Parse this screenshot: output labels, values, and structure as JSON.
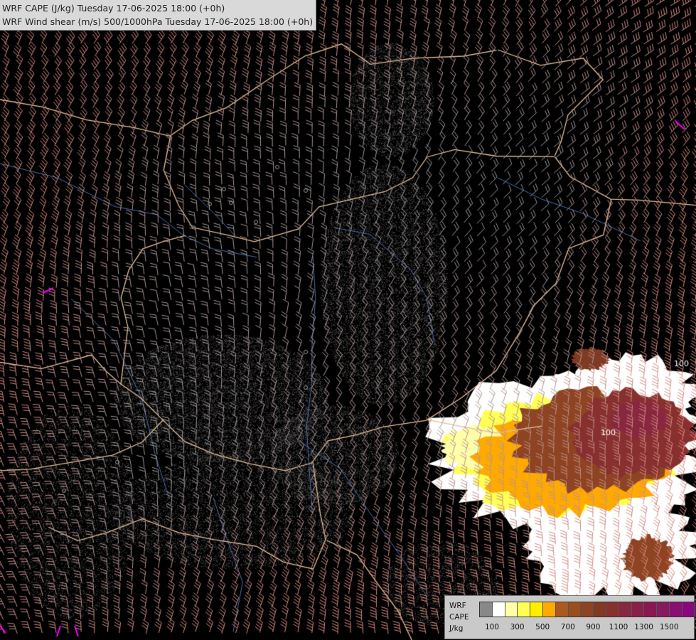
{
  "header": {
    "line1": "WRF CAPE (J/kg) Tuesday 17-06-2025 18:00 (+0h)",
    "line2": "WRF Wind shear (m/s) 500/1000hPa Tuesday 17-06-2025 18:00 (+0h)"
  },
  "legend": {
    "label_line1": "WRF",
    "label_line2": "CAPE",
    "label_line3": "J/kg",
    "colors": [
      "#888888",
      "#ffffff",
      "#ffffaa",
      "#ffff55",
      "#ffee00",
      "#ffaa00",
      "#aa5a1e",
      "#9a4e1e",
      "#8e4422",
      "#7e3a22",
      "#883030",
      "#882840",
      "#882048",
      "#881850",
      "#881a60",
      "#88106e",
      "#880a7a"
    ],
    "tick_labels": [
      "100",
      "300",
      "500",
      "700",
      "900",
      "1100",
      "1300",
      "1500"
    ]
  },
  "contour_labels": [
    "100",
    "100",
    "100",
    "100"
  ],
  "colors": {
    "background": "#000000",
    "borders": "#e8c09a",
    "rivers": "#4a6fb0",
    "barbs_low": "#9a9a9a",
    "barbs_high": "#d88a80",
    "shear_max": "#ff00ff"
  }
}
